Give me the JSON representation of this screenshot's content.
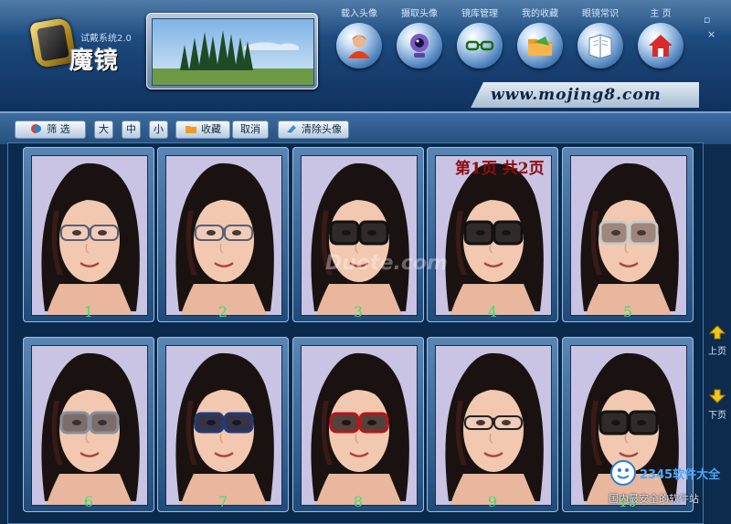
{
  "app": {
    "version_label": "试戴系统2.0",
    "title": "魔镜"
  },
  "toolbar": [
    {
      "label": "载入头像",
      "icon": "person-icon"
    },
    {
      "label": "摄取头像",
      "icon": "webcam-icon"
    },
    {
      "label": "镜库管理",
      "icon": "glasses-icon"
    },
    {
      "label": "我的收藏",
      "icon": "folder-icon"
    },
    {
      "label": "眼镜常识",
      "icon": "book-icon"
    },
    {
      "label": "主 页",
      "icon": "home-icon"
    }
  ],
  "window": {
    "restore": "▫",
    "close": "×"
  },
  "website": "www.mojing8.com",
  "filterbar": {
    "filter": "筛 选",
    "size_large": "大",
    "size_medium": "中",
    "size_small": "小",
    "favorite": "收藏",
    "cancel": "取消",
    "clear_avatar": "清除头像"
  },
  "page_info": "第1页  共2页",
  "watermark": "Duote.com",
  "cards": [
    {
      "num": "1",
      "glasses": "thin-gray"
    },
    {
      "num": "2",
      "glasses": "thin-gray"
    },
    {
      "num": "3",
      "glasses": "dark-sun"
    },
    {
      "num": "4",
      "glasses": "dark-sun"
    },
    {
      "num": "5",
      "glasses": "gradient-light"
    },
    {
      "num": "6",
      "glasses": "gradient-mid"
    },
    {
      "num": "7",
      "glasses": "navy"
    },
    {
      "num": "8",
      "glasses": "red"
    },
    {
      "num": "9",
      "glasses": "thin-black"
    },
    {
      "num": "10",
      "glasses": "dark-sun"
    }
  ],
  "nav": {
    "up": "上页",
    "down": "下页"
  },
  "corner": {
    "brand": "2345软件大全",
    "slogan": "国内最安全的软件站"
  },
  "colors": {
    "accent": "#1a4577",
    "page_info": "#8e0d0d",
    "numbers": "#36e07a"
  }
}
